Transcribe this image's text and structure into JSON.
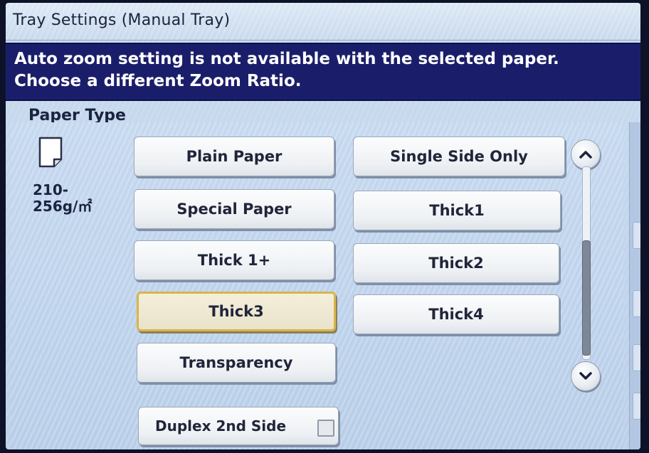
{
  "window": {
    "title": "Tray Settings (Manual Tray)"
  },
  "message": {
    "text": "Auto zoom setting is not available with the selected paper. Choose a different Zoom Ratio."
  },
  "paper_type": {
    "label": "Paper Type",
    "icon": "paper-sheet-icon",
    "weight": "210-256g/㎡"
  },
  "buttons": {
    "plain_paper": "Plain Paper",
    "single_side_only": "Single Side Only",
    "special_paper": "Special Paper",
    "thick1": "Thick1",
    "thick1_plus": "Thick 1+",
    "thick2": "Thick2",
    "thick3": "Thick3",
    "thick4": "Thick4",
    "transparency": "Transparency",
    "duplex_2nd_side": "Duplex 2nd Side"
  },
  "selected_option": "Thick3",
  "duplex_checked": false,
  "colors": {
    "message_bg": "#1a1e6a",
    "selected_border": "#d8b54a",
    "screen_bg": "#c9dbee"
  }
}
